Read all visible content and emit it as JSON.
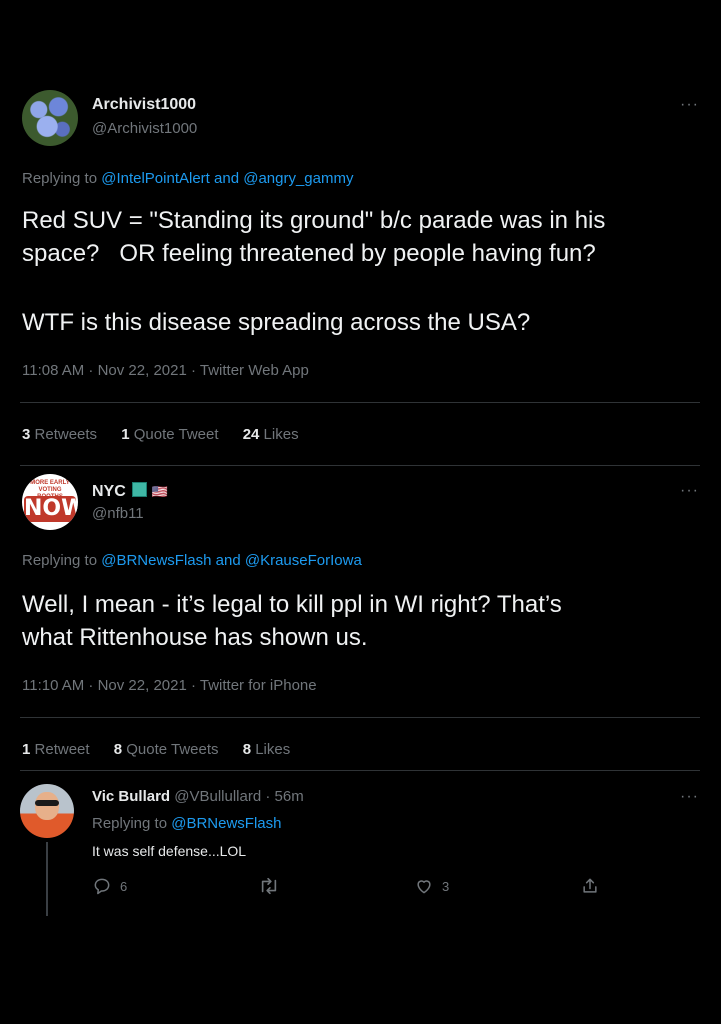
{
  "tweet1": {
    "display_name": "Archivist1000",
    "handle": "@Archivist1000",
    "replying_prefix": "Replying to",
    "reply_to_1": "@IntelPointAlert",
    "reply_and": "and",
    "reply_to_2": "@angry_gammy",
    "text_line1": "Red SUV = \"Standing its ground\" b/c parade was in his",
    "text_line2": "space?   OR feeling threatened by people having fun?",
    "text_line3": "WTF is this disease spreading across the USA?",
    "timestamp": "11:08 AM · Nov 22, 2021 · Twitter Web App",
    "retweets_count": "3",
    "retweets_label": "Retweets",
    "quotes_count": "1",
    "quotes_label": "Quote Tweet",
    "likes_count": "24",
    "likes_label": "Likes",
    "avatar_icon": "flower-avatar"
  },
  "tweet2": {
    "display_name": "NYC",
    "name_emojis": "🇺🇸",
    "handle": "@nfb11",
    "avatar_badge_top": "MORE EARLY VOTING BOOTHS",
    "avatar_badge_main": "NOW",
    "replying_prefix": "Replying to",
    "reply_to_1": "@BRNewsFlash",
    "reply_and": "and",
    "reply_to_2": "@KrauseForIowa",
    "text_line1": "Well, I mean - it’s legal to kill ppl in WI right? That’s",
    "text_line2": "what Rittenhouse has shown us.",
    "timestamp": "11:10 AM · Nov 22, 2021 · Twitter for iPhone",
    "retweets_count": "1",
    "retweets_label": "Retweet",
    "quotes_count": "8",
    "quotes_label": "Quote Tweets",
    "likes_count": "8",
    "likes_label": "Likes"
  },
  "tweet3": {
    "display_name": "Vic Bullard",
    "handle_time": "@VBullullard · 56m",
    "replying_prefix": "Replying to",
    "reply_to_1": "@BRNewsFlash",
    "text": "It was self defense...LOL",
    "reply_count": "6",
    "like_count": "3"
  },
  "more_label": "···",
  "colors": {
    "background": "#000000",
    "text": "#e7e9ea",
    "muted": "#71767b",
    "link": "#1d9bf0",
    "divider": "#2f3336",
    "badge_red": "#c0392b"
  }
}
